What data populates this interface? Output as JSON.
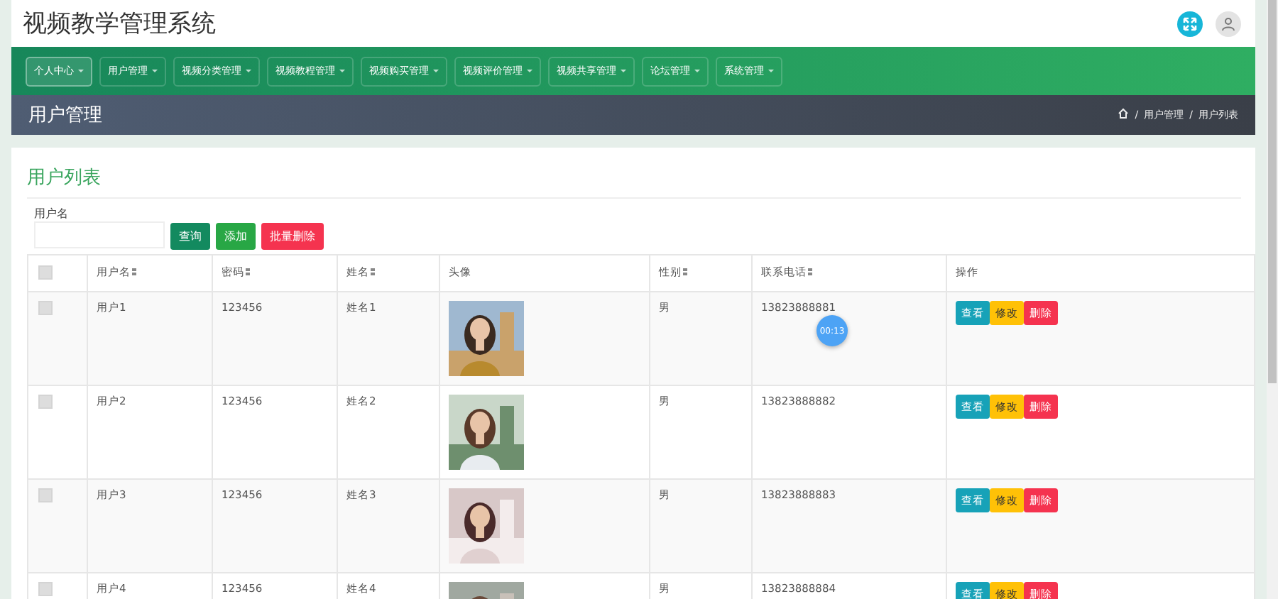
{
  "header": {
    "title": "视频教学管理系统"
  },
  "nav": [
    {
      "label": "个人中心",
      "selected": true
    },
    {
      "label": "用户管理",
      "selected": false
    },
    {
      "label": "视频分类管理",
      "selected": false
    },
    {
      "label": "视频教程管理",
      "selected": false
    },
    {
      "label": "视频购买管理",
      "selected": false
    },
    {
      "label": "视频评价管理",
      "selected": false
    },
    {
      "label": "视频共享管理",
      "selected": false
    },
    {
      "label": "论坛管理",
      "selected": false
    },
    {
      "label": "系统管理",
      "selected": false
    }
  ],
  "page_title": "用户管理",
  "breadcrumb": [
    {
      "separator": "/",
      "label": "用户管理"
    },
    {
      "separator": "/",
      "label": "用户列表"
    }
  ],
  "card_title": "用户列表",
  "search": {
    "label": "用户名",
    "buttons": [
      {
        "label": "查询",
        "kind": "query"
      },
      {
        "label": "添加",
        "kind": "add"
      },
      {
        "label": "批量删除",
        "kind": "delete"
      }
    ]
  },
  "table": {
    "columns": [
      {
        "kind": "checkbox",
        "checked": false
      },
      {
        "kind": "text",
        "label": "用户名",
        "sortable": true
      },
      {
        "kind": "text",
        "label": "密码",
        "sortable": true
      },
      {
        "kind": "text",
        "label": "姓名",
        "sortable": true
      },
      {
        "kind": "text",
        "label": "头像",
        "sortable": false
      },
      {
        "kind": "text",
        "label": "性别",
        "sortable": true
      },
      {
        "kind": "text",
        "label": "联系电话",
        "sortable": true
      },
      {
        "kind": "text",
        "label": "操作",
        "sortable": false
      }
    ],
    "rows": [
      {
        "cells": [
          {
            "kind": "checkbox",
            "checked": false
          },
          {
            "kind": "text",
            "text": "用户1"
          },
          {
            "kind": "text",
            "text": "123456"
          },
          {
            "kind": "text",
            "text": "姓名1"
          },
          {
            "kind": "picture"
          },
          {
            "kind": "text",
            "text": "男"
          },
          {
            "kind": "text",
            "text": "13823888881"
          },
          {
            "kind": "actions",
            "actions": [
              {
                "label": "查看",
                "kind": "view"
              },
              {
                "label": "修改",
                "kind": "edit"
              },
              {
                "label": "删除",
                "kind": "delete"
              }
            ]
          }
        ]
      },
      {
        "cells": [
          {
            "kind": "checkbox",
            "checked": false
          },
          {
            "kind": "text",
            "text": "用户2"
          },
          {
            "kind": "text",
            "text": "123456"
          },
          {
            "kind": "text",
            "text": "姓名2"
          },
          {
            "kind": "picture"
          },
          {
            "kind": "text",
            "text": "男"
          },
          {
            "kind": "text",
            "text": "13823888882"
          },
          {
            "kind": "actions",
            "actions": [
              {
                "label": "查看",
                "kind": "view"
              },
              {
                "label": "修改",
                "kind": "edit"
              },
              {
                "label": "删除",
                "kind": "delete"
              }
            ]
          }
        ]
      },
      {
        "cells": [
          {
            "kind": "checkbox",
            "checked": false
          },
          {
            "kind": "text",
            "text": "用户3"
          },
          {
            "kind": "text",
            "text": "123456"
          },
          {
            "kind": "text",
            "text": "姓名3"
          },
          {
            "kind": "picture"
          },
          {
            "kind": "text",
            "text": "男"
          },
          {
            "kind": "text",
            "text": "13823888883"
          },
          {
            "kind": "actions",
            "actions": [
              {
                "label": "查看",
                "kind": "view"
              },
              {
                "label": "修改",
                "kind": "edit"
              },
              {
                "label": "删除",
                "kind": "delete"
              }
            ]
          }
        ]
      },
      {
        "cells": [
          {
            "kind": "checkbox",
            "checked": false
          },
          {
            "kind": "text",
            "text": "用户4"
          },
          {
            "kind": "text",
            "text": "123456"
          },
          {
            "kind": "text",
            "text": "姓名4"
          },
          {
            "kind": "picture"
          },
          {
            "kind": "text",
            "text": "男"
          },
          {
            "kind": "text",
            "text": "13823888884"
          },
          {
            "kind": "actions",
            "actions": [
              {
                "label": "查看",
                "kind": "view"
              },
              {
                "label": "修改",
                "kind": "edit"
              },
              {
                "label": "删除",
                "kind": "delete"
              }
            ]
          }
        ]
      }
    ]
  },
  "timer_badge": "00:13"
}
